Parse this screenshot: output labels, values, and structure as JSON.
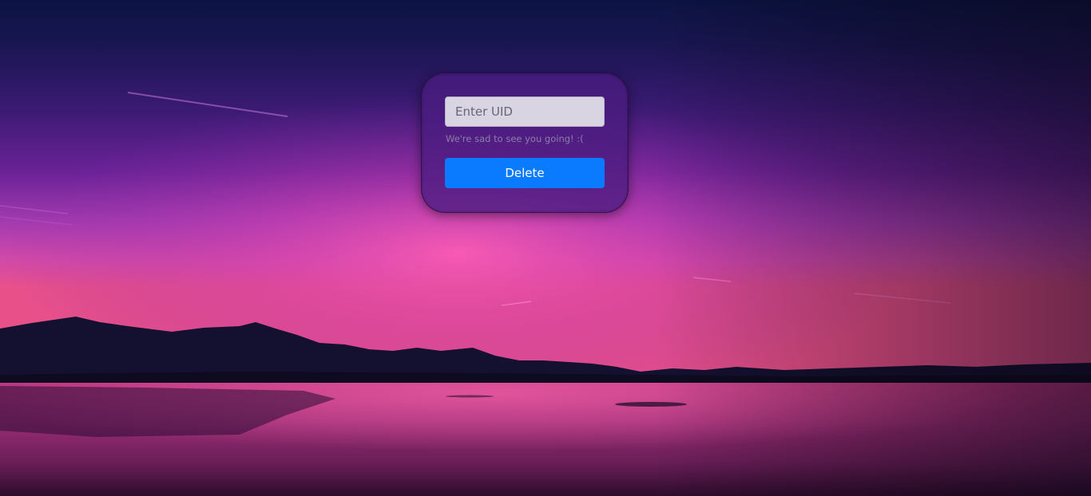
{
  "form": {
    "uid_placeholder": "Enter UID",
    "uid_value": "",
    "helper_text": "We're sad to see you going! :(",
    "delete_label": "Delete"
  },
  "colors": {
    "button": "#0a7bff",
    "card": "#4a1c80",
    "sky_top": "#0d1240",
    "horizon_glow": "#f25aa8"
  }
}
